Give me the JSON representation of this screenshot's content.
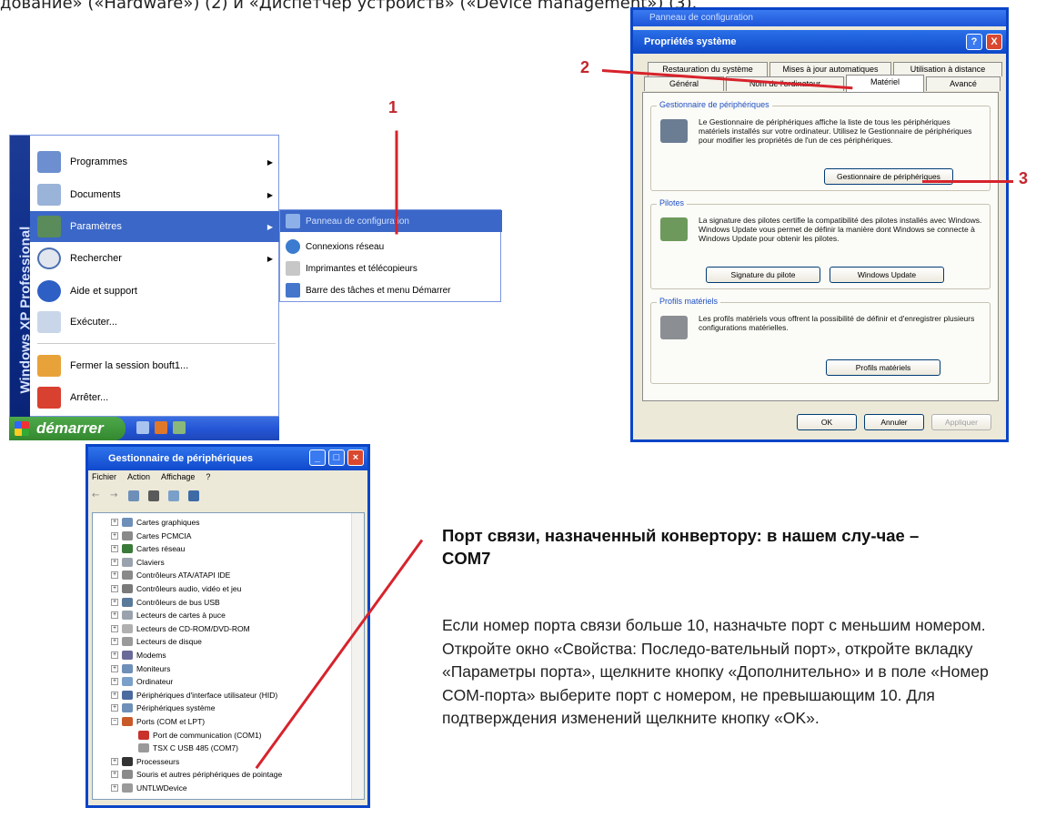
{
  "top_text": "дование» («Hardware») (2) и «Диспетчер устройств» («Device management») (3).",
  "markers": {
    "m1": "1",
    "m2": "2",
    "m3": "3"
  },
  "start_menu": {
    "sidebar_brand": "Windows XP Professional",
    "items": [
      {
        "label": "Programmes",
        "icon": "programs-icon"
      },
      {
        "label": "Documents",
        "icon": "documents-icon"
      },
      {
        "label": "Paramètres",
        "icon": "settings-icon"
      },
      {
        "label": "Rechercher",
        "icon": "search-icon"
      },
      {
        "label": "Aide et support",
        "icon": "help-icon"
      },
      {
        "label": "Exécuter...",
        "icon": "run-icon"
      },
      {
        "label": "Fermer la session bouft1...",
        "icon": "logoff-icon"
      },
      {
        "label": "Arrêter...",
        "icon": "shutdown-icon"
      }
    ],
    "start_button": "démarrer",
    "submenu": [
      {
        "label": "Panneau de configuration",
        "icon": "control-panel-icon"
      },
      {
        "label": "Connexions réseau",
        "icon": "network-icon"
      },
      {
        "label": "Imprimantes et télécopieurs",
        "icon": "printer-icon"
      },
      {
        "label": "Barre des tâches et menu Démarrer",
        "icon": "taskbar-icon"
      }
    ]
  },
  "system_properties": {
    "parent_title": "Panneau de configuration",
    "title": "Propriétés système",
    "help_btn": "?",
    "close_btn": "X",
    "tabs_row1": [
      "Restauration du système",
      "Mises à jour automatiques",
      "Utilisation à distance"
    ],
    "tabs_row2": [
      "Général",
      "Nom de l'ordinateur",
      "Matériel",
      "Avancé"
    ],
    "groups": [
      {
        "label": "Gestionnaire de périphériques",
        "text": "Le Gestionnaire de périphériques affiche la liste de tous les périphériques matériels installés sur votre ordinateur. Utilisez le Gestionnaire de périphériques pour modifier les propriétés de l'un de ces périphériques.",
        "buttons": [
          "Gestionnaire de périphériques"
        ]
      },
      {
        "label": "Pilotes",
        "text": "La signature des pilotes certifie la compatibilité des pilotes installés avec Windows. Windows Update vous permet de définir la manière dont Windows se connecte à Windows Update pour obtenir les pilotes.",
        "buttons": [
          "Signature du pilote",
          "Windows Update"
        ]
      },
      {
        "label": "Profils matériels",
        "text": "Les profils matériels vous offrent la possibilité de définir et d'enregistrer plusieurs configurations matérielles.",
        "buttons": [
          "Profils matériels"
        ]
      }
    ],
    "bottom_buttons": [
      "OK",
      "Annuler",
      "Appliquer"
    ]
  },
  "device_manager": {
    "title": "Gestionnaire de périphériques",
    "menu": [
      "Fichier",
      "Action",
      "Affichage",
      "?"
    ],
    "tree": [
      {
        "label": "Cartes graphiques",
        "pm": "+"
      },
      {
        "label": "Cartes PCMCIA",
        "pm": "+"
      },
      {
        "label": "Cartes réseau",
        "pm": "+"
      },
      {
        "label": "Claviers",
        "pm": "+"
      },
      {
        "label": "Contrôleurs ATA/ATAPI IDE",
        "pm": "+"
      },
      {
        "label": "Contrôleurs audio, vidéo et jeu",
        "pm": "+"
      },
      {
        "label": "Contrôleurs de bus USB",
        "pm": "+"
      },
      {
        "label": "Lecteurs de cartes à puce",
        "pm": "+"
      },
      {
        "label": "Lecteurs de CD-ROM/DVD-ROM",
        "pm": "+"
      },
      {
        "label": "Lecteurs de disque",
        "pm": "+"
      },
      {
        "label": "Modems",
        "pm": "+"
      },
      {
        "label": "Moniteurs",
        "pm": "+"
      },
      {
        "label": "Ordinateur",
        "pm": "+"
      },
      {
        "label": "Périphériques d'interface utilisateur (HID)",
        "pm": "+"
      },
      {
        "label": "Périphériques système",
        "pm": "+"
      },
      {
        "label": "Ports (COM et LPT)",
        "pm": "−"
      },
      {
        "label": "Port de communication (COM1)",
        "pm": ""
      },
      {
        "label": "TSX C USB 485 (COM7)",
        "pm": ""
      },
      {
        "label": "Processeurs",
        "pm": "+"
      },
      {
        "label": "Souris et autres périphériques de pointage",
        "pm": "+"
      },
      {
        "label": "UNTLWDevice",
        "pm": "+"
      }
    ]
  },
  "caption": {
    "heading": "Порт связи, назначенный конвертору: в нашем слу-чае – COM7",
    "paragraph": "Если номер порта связи больше 10, назначьте порт с меньшим номером. Откройте окно «Свойства: Последо-вательный порт», откройте вкладку «Параметры порта», щелкните кнопку «Дополнительно» и в поле «Номер COM-порта» выберите порт с номером, не превышающим 10. Для подтверждения изменений щелкните кнопку «OK»."
  },
  "colors": {
    "accent_red": "#d7232c",
    "xp_blue": "#0a45c7",
    "xp_green": "#34882f"
  }
}
